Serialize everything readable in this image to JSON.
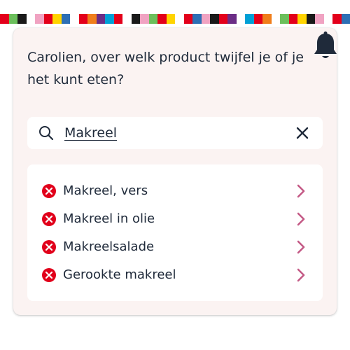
{
  "header": {
    "stripe_colors": [
      "#e3001b",
      "#6bbf5b",
      "#1a1a1a",
      "#ffffff",
      "#f0a3c2",
      "#e3001b",
      "#ffd400",
      "#2d6fb5",
      "#ffffff",
      "#e3001b",
      "#f07e1b",
      "#6b2d86",
      "#00a0d6",
      "#e3001b",
      "#ffffff",
      "#1a1a1a",
      "#f0a3c2",
      "#6bbf5b",
      "#e3001b",
      "#ffd400",
      "#ffffff",
      "#e3001b",
      "#2d6fb5",
      "#f0a3c2",
      "#1a1a1a",
      "#e3001b",
      "#6b2d86",
      "#ffffff",
      "#00a0d6",
      "#e3001b",
      "#f07e1b",
      "#ffffff",
      "#6bbf5b",
      "#e3001b",
      "#ffd400",
      "#1a1a1a",
      "#f0a3c2",
      "#ffffff",
      "#e3001b",
      "#2d6fb5"
    ],
    "bell_icon": "bell-icon"
  },
  "prompt": {
    "question": "Carolien, over welk product twijfel je of je het kunt eten?"
  },
  "search": {
    "value": "Makreel",
    "search_icon": "search-icon",
    "clear_icon": "close-icon"
  },
  "results": [
    {
      "label": "Makreel, vers",
      "status": "not-allowed",
      "status_icon": "x-circle-icon"
    },
    {
      "label": "Makreel in olie",
      "status": "not-allowed",
      "status_icon": "x-circle-icon"
    },
    {
      "label": "Makreelsalade",
      "status": "not-allowed",
      "status_icon": "x-circle-icon"
    },
    {
      "label": "Gerookte makreel",
      "status": "not-allowed",
      "status_icon": "x-circle-icon"
    }
  ],
  "colors": {
    "text": "#1f2a3a",
    "status_red": "#e1001a",
    "chevron_pink": "#c45a86",
    "card_bg": "#fbf3f2"
  }
}
